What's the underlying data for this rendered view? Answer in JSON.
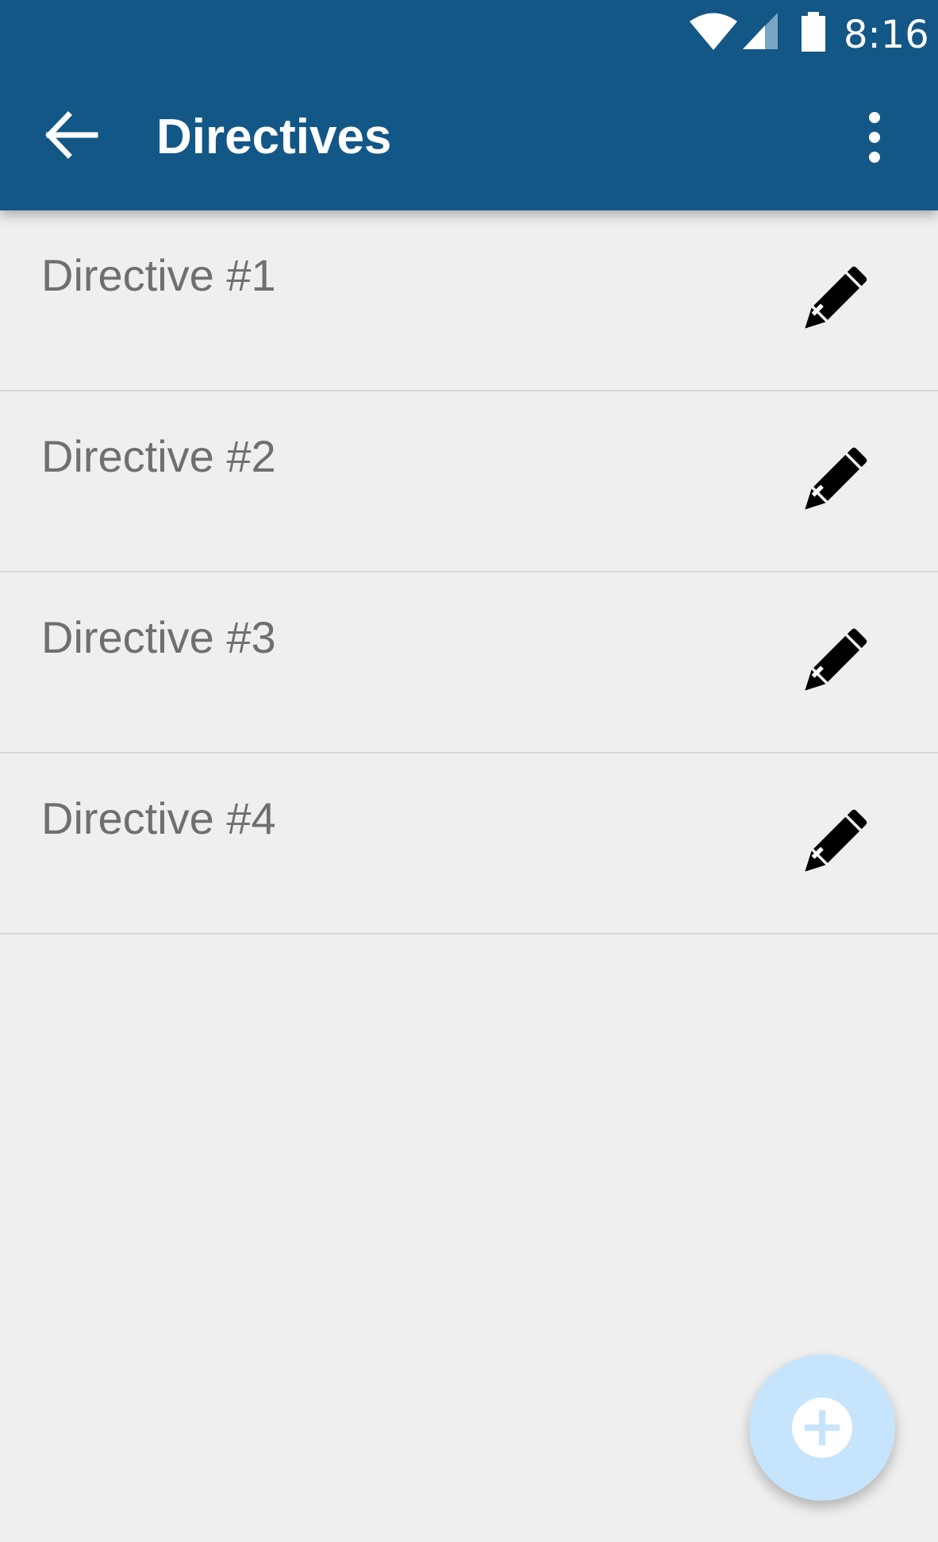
{
  "status_bar": {
    "time": "8:16",
    "icons": [
      "wifi-icon",
      "signal-icon",
      "battery-icon"
    ]
  },
  "toolbar": {
    "title": "Directives",
    "back_icon": "arrow-left-icon",
    "menu_icon": "more-vertical-icon"
  },
  "directives": [
    {
      "label": "Directive #1",
      "action_icon": "pencil-icon"
    },
    {
      "label": "Directive #2",
      "action_icon": "pencil-icon"
    },
    {
      "label": "Directive #3",
      "action_icon": "pencil-icon"
    },
    {
      "label": "Directive #4",
      "action_icon": "pencil-icon"
    }
  ],
  "fab": {
    "icon": "plus-circle-icon"
  },
  "colors": {
    "app_bar": "#135787",
    "background": "#efefef",
    "row_text": "#6f6f6f",
    "divider": "#d8d8d8",
    "fab": "#c6e4fb"
  }
}
